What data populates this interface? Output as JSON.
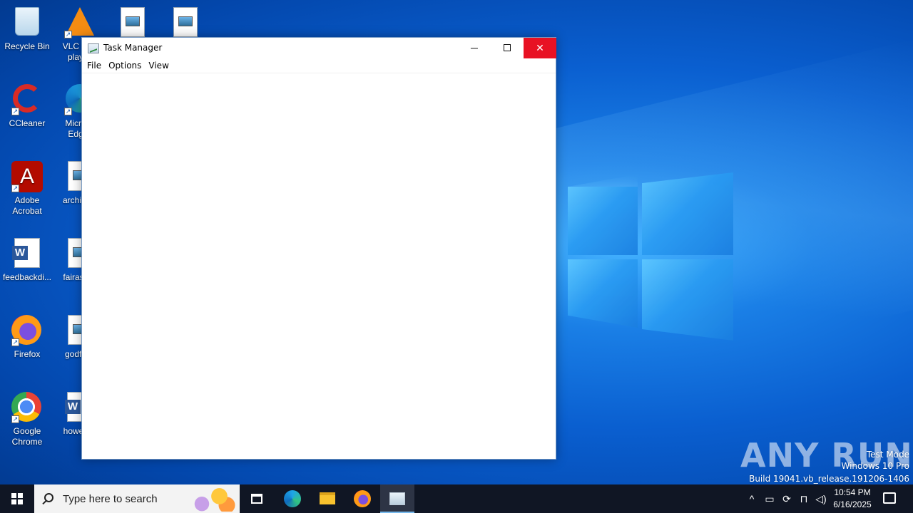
{
  "desktop": {
    "icons": [
      {
        "label": "Recycle Bin"
      },
      {
        "label": "VLC media player",
        "visible_label": "VLC m… play…"
      },
      {
        "label": "CCleaner"
      },
      {
        "label": "Microsoft Edge",
        "visible_label": "Micro… Edg…"
      },
      {
        "label": "Adobe Acrobat"
      },
      {
        "label": "archite…"
      },
      {
        "label": "feedbackdi..."
      },
      {
        "label": "fairass…"
      },
      {
        "label": "Firefox"
      },
      {
        "label": "godfe…"
      },
      {
        "label": "Google Chrome"
      },
      {
        "label": "howev…"
      }
    ]
  },
  "window": {
    "title": "Task Manager",
    "menu": [
      "File",
      "Options",
      "View"
    ],
    "controls": {
      "minimize": "─",
      "close": "✕"
    }
  },
  "watermark": {
    "brand": "ANY RUN",
    "line1": "Test Mode",
    "line2": "Windows 10 Pro",
    "line3": "Build 19041.vb_release.191206-1406"
  },
  "taskbar": {
    "search_placeholder": "Type here to search",
    "time": "10:54 PM",
    "date": "6/16/2025",
    "tray_chevron": "^"
  },
  "colors": {
    "close_button": "#e81123",
    "taskbar": "#101624",
    "desktop": "#0a5fd0"
  }
}
